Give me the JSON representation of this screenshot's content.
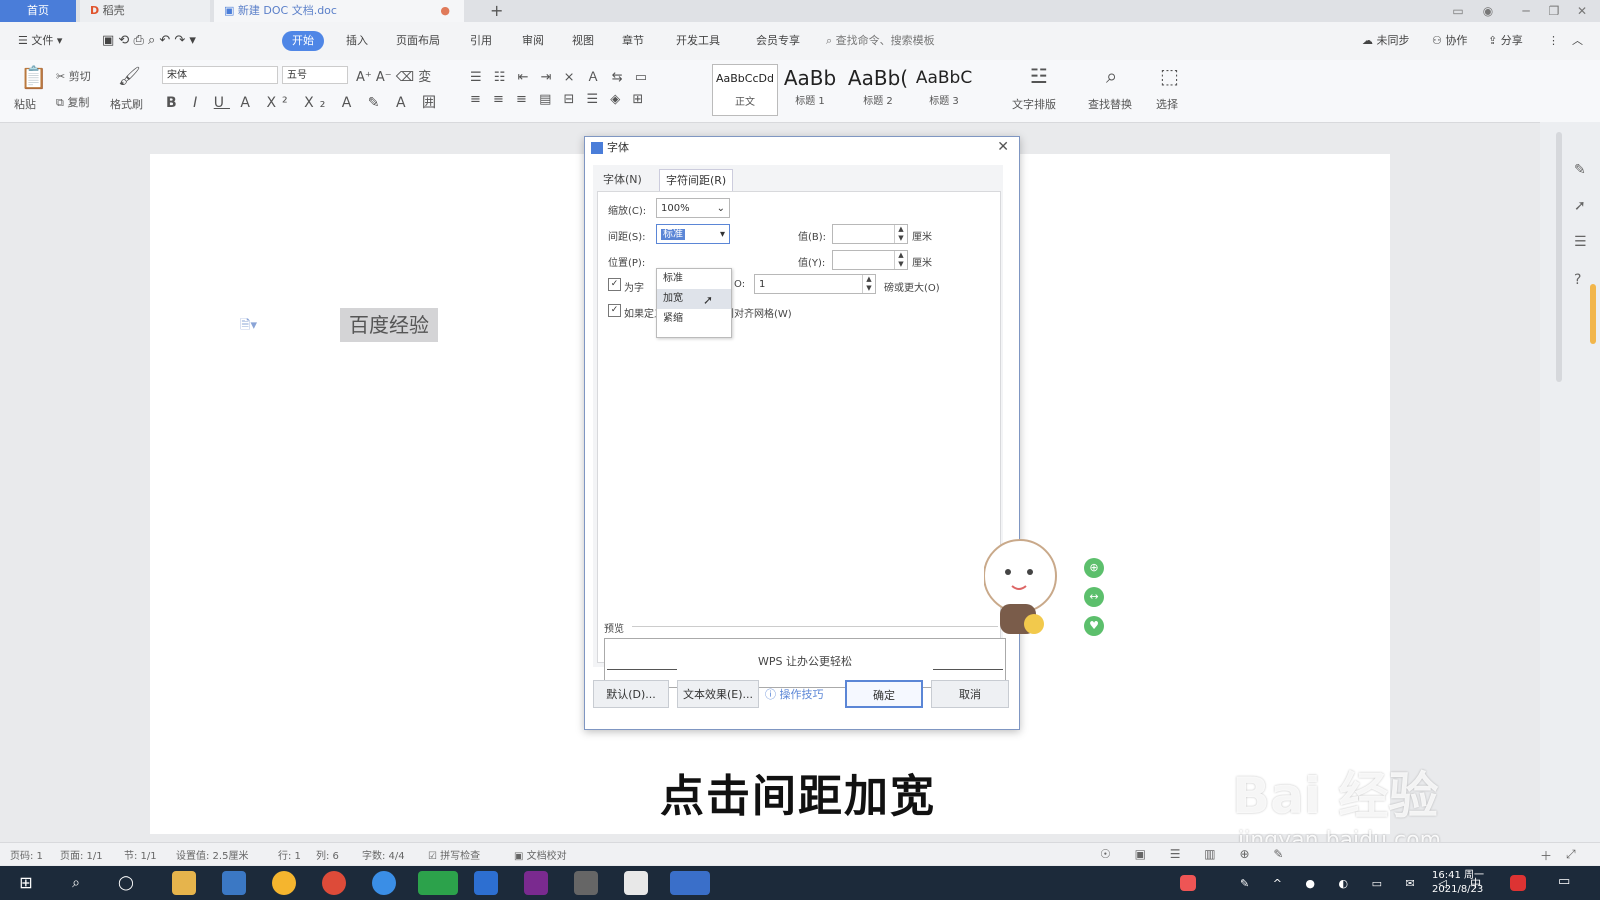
{
  "tabs": {
    "home": "首页",
    "daoke": "稻壳",
    "doc": "新建 DOC 文档.doc"
  },
  "menu": {
    "file": "文件",
    "items": [
      "开始",
      "插入",
      "页面布局",
      "引用",
      "审阅",
      "视图",
      "章节",
      "开发工具",
      "会员专享"
    ],
    "search": "查找命令、搜索模板",
    "sync": "未同步",
    "collab": "协作",
    "share": "分享"
  },
  "ribbon": {
    "paste": "粘贴",
    "cut": "剪切",
    "copy": "复制",
    "format_painter": "格式刷",
    "font_name": "宋体",
    "font_size": "五号",
    "styles": [
      {
        "sample": "AaBbCcDd",
        "label": "正文"
      },
      {
        "sample": "AaBb",
        "label": "标题 1"
      },
      {
        "sample": "AaBb(",
        "label": "标题 2"
      },
      {
        "sample": "AaBbC",
        "label": "标题 3"
      }
    ],
    "text_layout": "文字排版",
    "find_replace": "查找替换",
    "select": "选择"
  },
  "document": {
    "text": "百度经验"
  },
  "dialog": {
    "title": "字体",
    "tab_font": "字体(N)",
    "tab_spacing": "字符间距(R)",
    "scale_label": "缩放(C):",
    "scale_value": "100%",
    "spacing_label": "间距(S):",
    "spacing_value": "标准",
    "position_label": "位置(P):",
    "value_b_label": "值(B):",
    "value_y_label": "值(Y):",
    "unit": "厘米",
    "dropdown_options": [
      "标准",
      "加宽",
      "紧缩"
    ],
    "kerning_label": "为字",
    "kerning_suffix": "O:",
    "kerning_value": "1",
    "kerning_after": "磅或更大(O)",
    "grid_label": "如果定义了文档网格，则对齐网格(W)",
    "preview_label": "预览",
    "preview_text": "WPS 让办公更轻松",
    "default_btn": "默认(D)...",
    "text_effect_btn": "文本效果(E)...",
    "tips": "操作技巧",
    "ok": "确定",
    "cancel": "取消"
  },
  "status": {
    "page_num": "页码: 1",
    "pages": "页面: 1/1",
    "section": "节: 1/1",
    "set_value": "设置值: 2.5厘米",
    "row": "行: 1",
    "col": "列: 6",
    "words": "字数: 4/4",
    "spell": "拼写检查",
    "proof": "文档校对"
  },
  "caption": "点击间距加宽",
  "watermark": {
    "brand": "Bai  经验",
    "url": "jingyan.baidu.com"
  },
  "clock": {
    "time": "16:41 周一",
    "date": "2021/8/23"
  },
  "colors": {
    "accent": "#4f86e6",
    "dialog_border": "#7f96c2",
    "ok_border": "#5b86d6"
  }
}
